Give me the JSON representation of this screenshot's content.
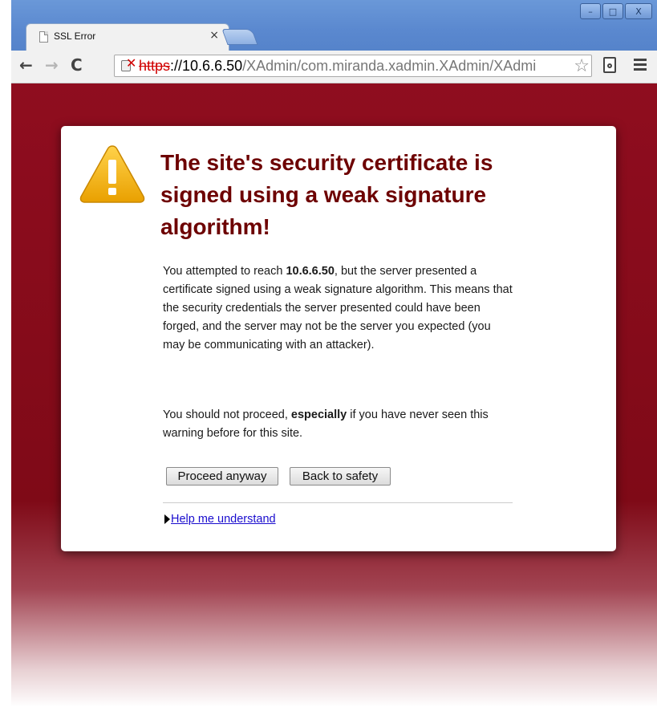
{
  "tab": {
    "title": "SSL Error",
    "close_glyph": "×"
  },
  "window_controls": {
    "minimize": "–",
    "maximize": "□",
    "close": "X"
  },
  "toolbar": {
    "back_glyph": "←",
    "forward_glyph": "→",
    "reload_glyph": "C",
    "url_scheme": "https",
    "url_host": "://10.6.6.50",
    "url_path": "/XAdmin/com.miranda.xadmin.XAdmin/XAdmi",
    "star_glyph": "☆"
  },
  "page": {
    "title": "The site's security certificate is signed using a weak signature algorithm!",
    "p1_pre": "You attempted to reach ",
    "p1_host": "10.6.6.50",
    "p1_post": ", but the server presented a certificate signed using a weak signature algorithm. This means that the security credentials the server presented could have been forged, and the server may not be the server you expected (you may be communicating with an attacker).",
    "p2_pre": "You should not proceed, ",
    "p2_strong": "especially",
    "p2_post": " if you have never seen this warning before for this site.",
    "proceed_label": "Proceed anyway",
    "back_label": "Back to safety",
    "help_label": "Help me understand"
  },
  "colors": {
    "background_red": "#8f0d1f",
    "title_red": "#6d0000",
    "link_blue": "#1a0dce",
    "warning_yellow": "#f2b20f"
  }
}
